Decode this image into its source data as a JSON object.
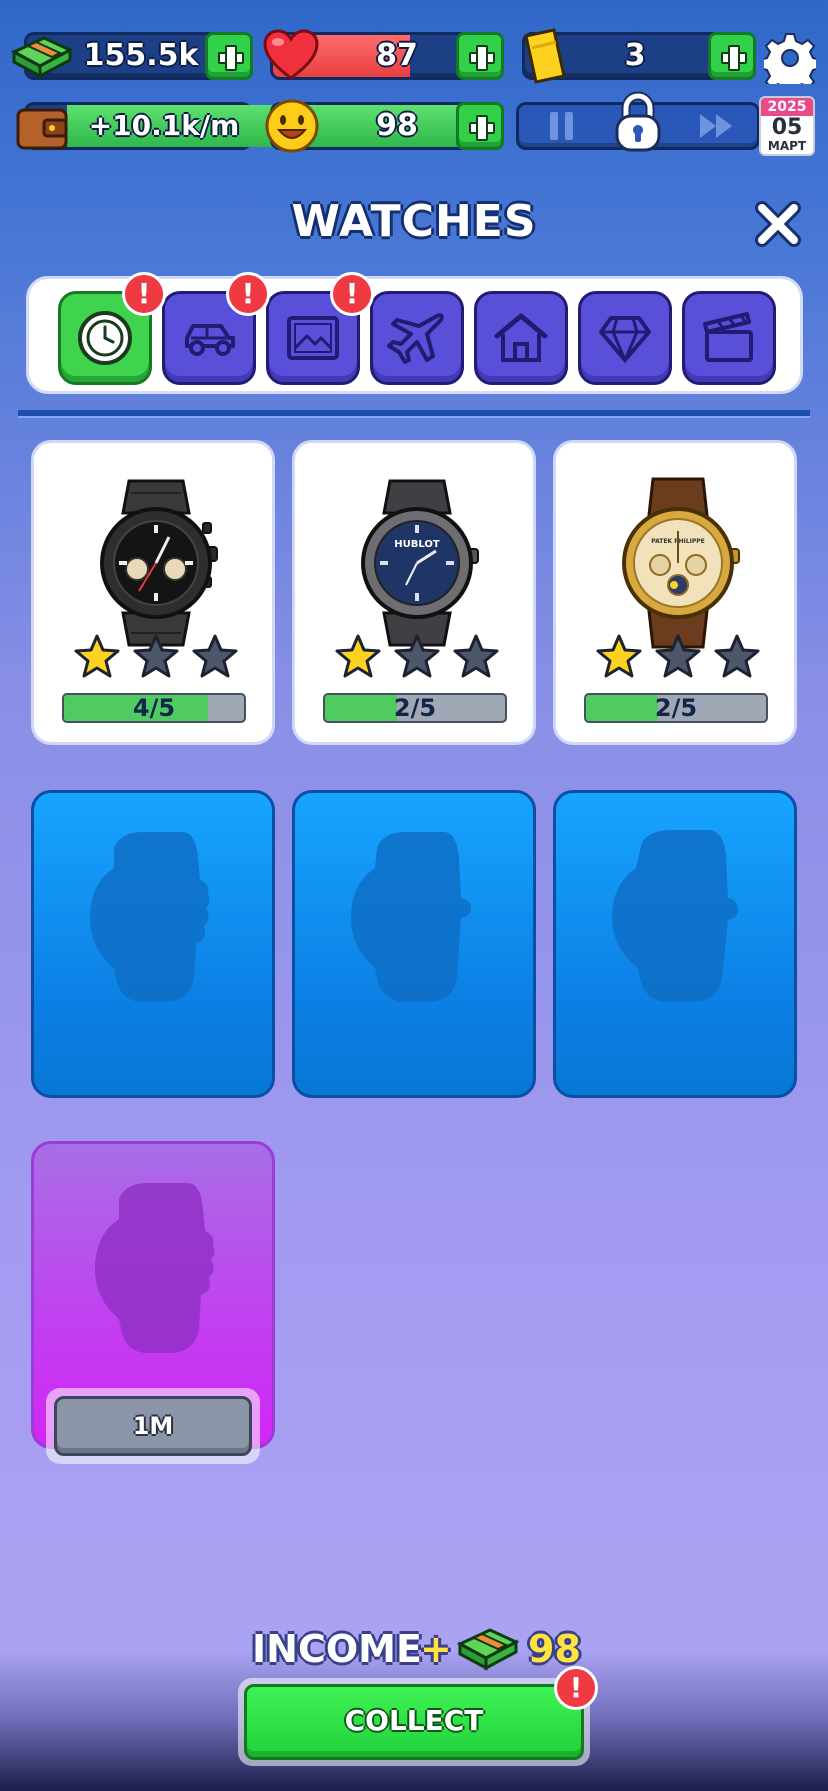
{
  "hud": {
    "cash": "155.5k",
    "hearts": "87",
    "hearts_level": 0.6,
    "tickets": "3",
    "income_rate": "+10.1k/m",
    "happiness": "98",
    "happiness_level": 0.98,
    "calendar": {
      "year": "2025",
      "day": "05",
      "month": "МАРТ"
    }
  },
  "title": "WATCHES",
  "tabs": [
    {
      "name": "watches",
      "icon": "watch-icon",
      "active": true,
      "alert": true
    },
    {
      "name": "cars",
      "icon": "car-icon",
      "active": false,
      "alert": true
    },
    {
      "name": "paintings",
      "icon": "picture-icon",
      "active": false,
      "alert": true
    },
    {
      "name": "planes",
      "icon": "plane-icon",
      "active": false,
      "alert": false
    },
    {
      "name": "houses",
      "icon": "house-icon",
      "active": false,
      "alert": false
    },
    {
      "name": "jewelry",
      "icon": "diamond-icon",
      "active": false,
      "alert": false
    },
    {
      "name": "movies",
      "icon": "clapperboard-icon",
      "active": false,
      "alert": false
    }
  ],
  "alert_mark": "!",
  "cards": [
    {
      "id": "black-chronograph",
      "stars": 1,
      "max_stars": 3,
      "progress": "4/5",
      "progress_value": 0.8,
      "dial_text": ""
    },
    {
      "id": "hublot",
      "stars": 1,
      "max_stars": 3,
      "progress": "2/5",
      "progress_value": 0.4,
      "dial_text": "HUBLOT"
    },
    {
      "id": "patek-philippe",
      "stars": 1,
      "max_stars": 3,
      "progress": "2/5",
      "progress_value": 0.4,
      "dial_text": "PATEK PHILIPPE"
    }
  ],
  "locked_slots": 3,
  "premium_slot": {
    "price": "1M"
  },
  "footer": {
    "income_label": "INCOME",
    "income_plus": "+",
    "income_value": "98",
    "collect_label": "COLLECT"
  },
  "colors": {
    "accent_green": "#33d14a",
    "tab_purple": "#5a4fd8",
    "alert_red": "#ef3a43",
    "star_gold": "#ffd21f"
  }
}
